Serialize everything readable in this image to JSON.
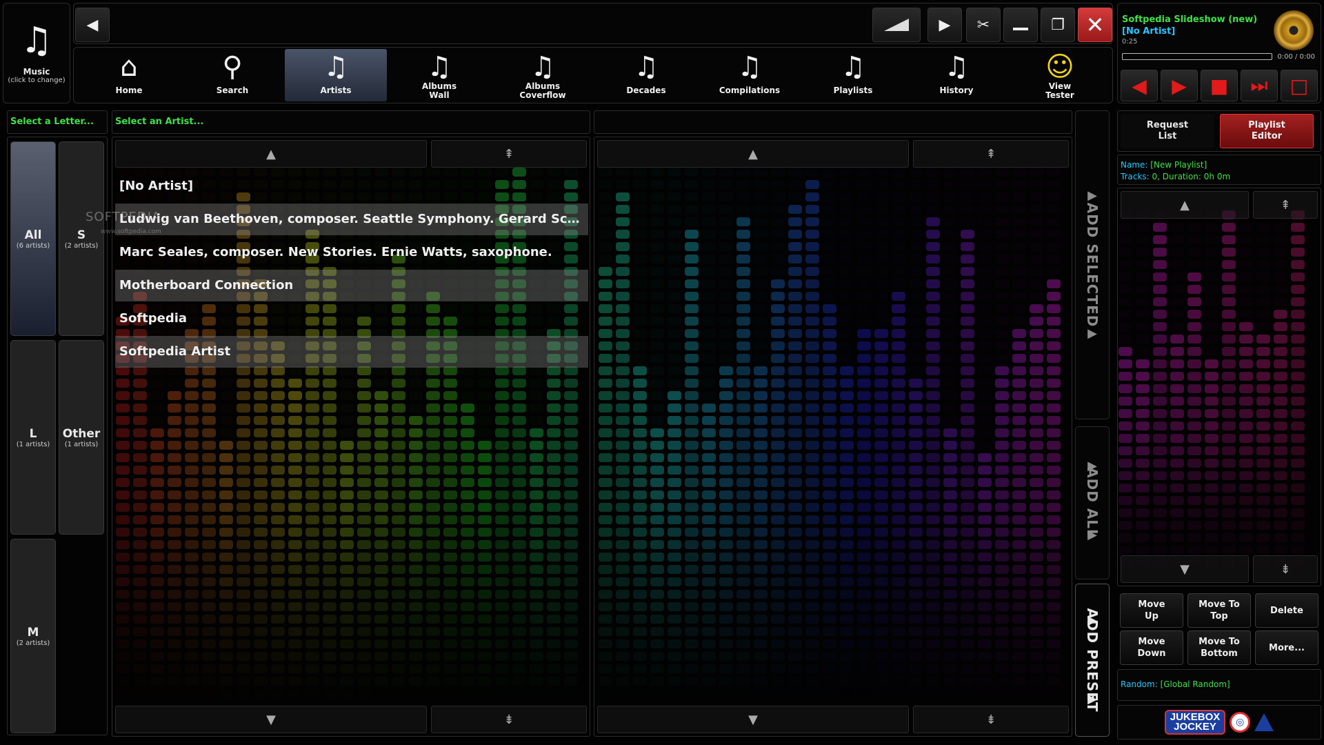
{
  "music_block": {
    "label": "Music",
    "sub": "(click to change)"
  },
  "nav": [
    {
      "label": "Home",
      "icon": "home-icon"
    },
    {
      "label": "Search",
      "icon": "search-icon"
    },
    {
      "label": "Artists",
      "icon": "music-note-icon",
      "active": true
    },
    {
      "label": "Albums Wall",
      "icon": "music-note-icon"
    },
    {
      "label": "Albums Coverflow",
      "icon": "music-note-icon"
    },
    {
      "label": "Decades",
      "icon": "music-note-icon"
    },
    {
      "label": "Compilations",
      "icon": "music-note-icon"
    },
    {
      "label": "Playlists",
      "icon": "music-note-icon"
    },
    {
      "label": "History",
      "icon": "music-note-icon"
    },
    {
      "label": "View Tester",
      "icon": "view-tester-icon"
    }
  ],
  "player": {
    "title": "Softpedia Slideshow (new)",
    "artist": "[No Artist]",
    "elapsed": "0:25",
    "time": "0:00 / 0:00",
    "progress_fraction": 0
  },
  "letters": {
    "header": "Select a Letter...",
    "tiles": [
      {
        "letter": "All",
        "count": "(6 artists)",
        "active": true
      },
      {
        "letter": "S",
        "count": "(2 artists)"
      },
      {
        "letter": "L",
        "count": "(1 artists)"
      },
      {
        "letter": "Other",
        "count": "(1 artists)"
      },
      {
        "letter": "M",
        "count": "(2 artists)"
      }
    ]
  },
  "artists": {
    "header": "Select an Artist...",
    "items": [
      "[No Artist]",
      "Ludwig van Beethoven, composer. Seattle Symphony. Gerard Schwarz, dire...",
      "Marc Seales, composer. New Stories. Ernie Watts, saxophone.",
      "Motherboard Connection",
      "Softpedia",
      "Softpedia Artist"
    ]
  },
  "side_buttons": {
    "add_selected": "ADD SELECTED",
    "add_all": "ADD ALL",
    "add_preset": "ADD PRESET"
  },
  "editor": {
    "tab_request": "Request List",
    "tab_editor": "Playlist Editor",
    "name_label": "Name:",
    "name_value": "[New Playlist]",
    "tracks_label": "Tracks:",
    "tracks_value": "0, Duration: 0h 0m",
    "buttons": [
      "Move Up",
      "Move To Top",
      "Delete",
      "Move Down",
      "Move To Bottom",
      "More..."
    ],
    "random_label": "Random:",
    "random_value": "[Global Random]"
  },
  "logo": {
    "line1": "JUKEBOX",
    "line2": "JOCKEY"
  },
  "watermark": {
    "text": "SOFTPEDIA",
    "sub": "www.softpedia.com"
  },
  "colors": {
    "green": "#41e04a",
    "cyan": "#29c8ff",
    "red": "#e21a1a",
    "accent_tab": "#a42020"
  }
}
